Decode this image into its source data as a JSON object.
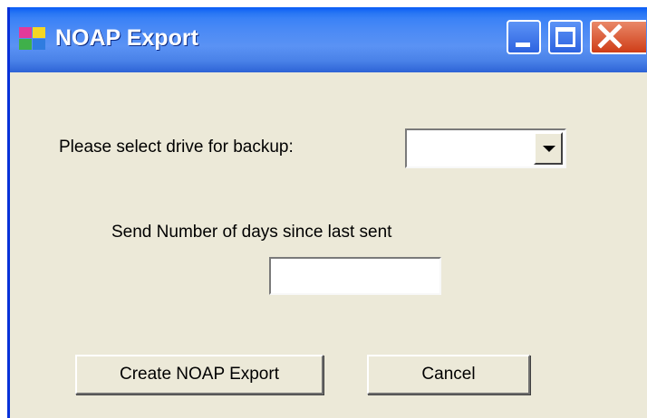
{
  "window": {
    "title": "NOAP Export",
    "icon": "app-icon",
    "controls": [
      "minimize-icon",
      "maximize-icon",
      "close-icon"
    ]
  },
  "form": {
    "drive_label": "Please select drive for backup:",
    "drive_value": "",
    "days_label": "Send Number of days since last sent",
    "days_value": ""
  },
  "buttons": {
    "create_label": "Create NOAP Export",
    "cancel_label": "Cancel"
  },
  "colors": {
    "titlebar": "#2a78f4",
    "window_bg": "#ece9d8",
    "close": "#cf3d17"
  }
}
